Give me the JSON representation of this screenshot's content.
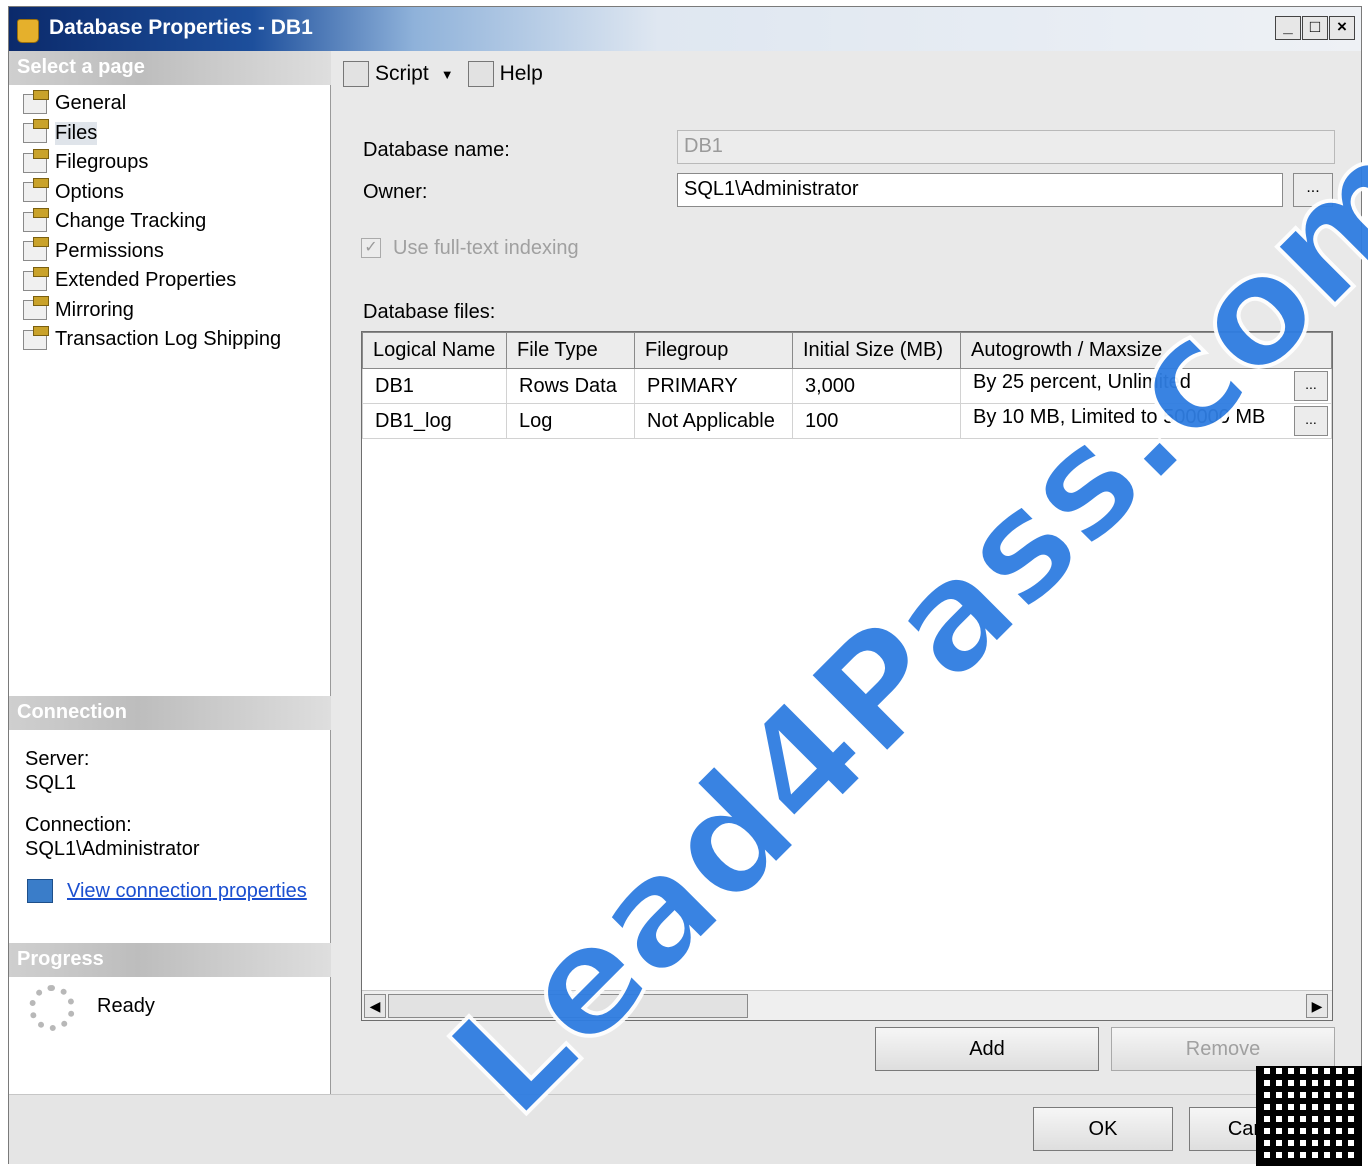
{
  "window": {
    "title": "Database Properties - DB1",
    "controls": [
      "_",
      "□",
      "×"
    ]
  },
  "left": {
    "select_page_header": "Select a page",
    "pages": [
      {
        "label": "General"
      },
      {
        "label": "Files",
        "selected": true
      },
      {
        "label": "Filegroups"
      },
      {
        "label": "Options"
      },
      {
        "label": "Change Tracking"
      },
      {
        "label": "Permissions"
      },
      {
        "label": "Extended Properties"
      },
      {
        "label": "Mirroring"
      },
      {
        "label": "Transaction Log Shipping"
      }
    ],
    "connection_header": "Connection",
    "server_label": "Server:",
    "server_value": "SQL1",
    "connection_label": "Connection:",
    "connection_value": "SQL1\\Administrator",
    "view_connection_link": "View connection properties",
    "progress_header": "Progress",
    "progress_status": "Ready"
  },
  "toolbar": {
    "script_label": "Script",
    "help_label": "Help"
  },
  "form": {
    "db_name_label": "Database name:",
    "db_name_value": "DB1",
    "owner_label": "Owner:",
    "owner_value": "SQL1\\Administrator",
    "ellipsis": "...",
    "fulltext_label": "Use full-text indexing",
    "fulltext_checked": true,
    "db_files_label": "Database files:"
  },
  "files_table": {
    "columns": [
      "Logical Name",
      "File Type",
      "Filegroup",
      "Initial Size (MB)",
      "Autogrowth / Maxsize"
    ],
    "rows": [
      [
        "DB1",
        "Rows Data",
        "PRIMARY",
        "3,000",
        "By 25 percent, Unlimited"
      ],
      [
        "DB1_log",
        "Log",
        "Not Applicable",
        "100",
        "By 10 MB, Limited to 500000 MB"
      ]
    ]
  },
  "buttons": {
    "add": "Add",
    "remove": "Remove",
    "ok": "OK",
    "cancel": "Cancel"
  },
  "watermark": "Lead4Pass.com"
}
